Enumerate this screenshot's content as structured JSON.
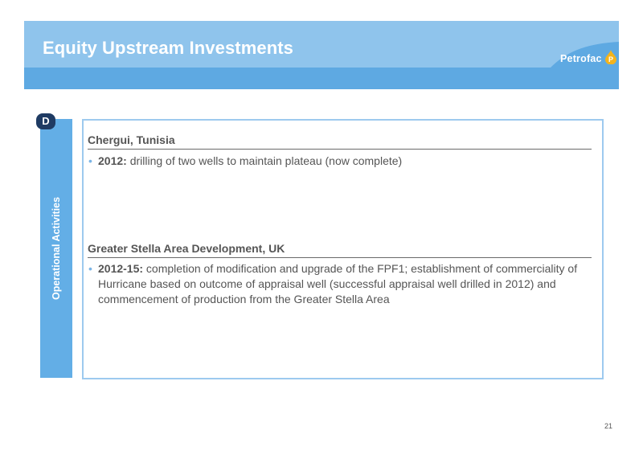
{
  "header": {
    "title": "Equity Upstream Investments",
    "logo_text": "Petrofac",
    "logo_mark": "P",
    "colors": {
      "banner_light": "#8fc4ec",
      "banner_dark": "#5ea9e2"
    }
  },
  "side_panel": {
    "badge": "D",
    "label": "Operational Activities",
    "color": "#63aee6"
  },
  "sections": [
    {
      "heading": "Chergui, Tunisia",
      "bullet_year": "2012:",
      "bullet_text": " drilling of two wells to maintain plateau (now complete)"
    },
    {
      "heading": "Greater Stella Area Development, UK",
      "bullet_year": "2012-15:",
      "bullet_text": " completion of modification and upgrade of the FPF1; establishment of commerciality of Hurricane based on outcome of appraisal well (successful appraisal well drilled in 2012) and commencement of production from the Greater Stella Area"
    }
  ],
  "footer": {
    "page_number": "21"
  }
}
